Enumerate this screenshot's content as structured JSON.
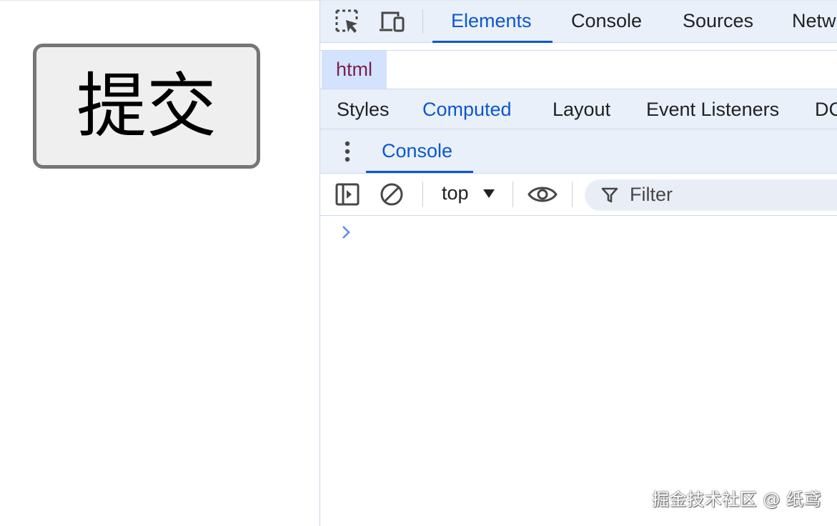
{
  "page": {
    "submit_button_label": "提交"
  },
  "devtools": {
    "main_tabs": [
      "Elements",
      "Console",
      "Sources",
      "Netw"
    ],
    "active_main_tab": "Elements",
    "breadcrumb": "html",
    "sub_tabs": [
      "Styles",
      "Computed",
      "Layout",
      "Event Listeners",
      "DC"
    ],
    "active_sub_tab": "Computed",
    "drawer_tab": "Console",
    "console_toolbar": {
      "context": "top",
      "filter_placeholder": "Filter"
    }
  },
  "watermark": "掘金技术社区 @ 纸鸢",
  "colors": {
    "accent": "#0b57d0",
    "tab_bar_bg": "#eaf0f9",
    "breadcrumb_bg": "#d3e3fd",
    "breadcrumb_text": "#7a2150"
  }
}
